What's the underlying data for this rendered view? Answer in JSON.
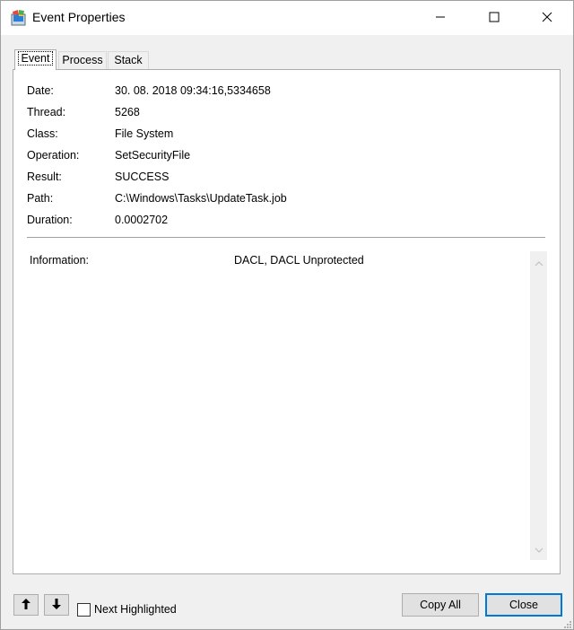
{
  "window": {
    "title": "Event Properties",
    "icon": "procmon-app-icon"
  },
  "titlebar_buttons": [
    "minimize-icon",
    "maximize-icon",
    "close-icon"
  ],
  "tabs": [
    {
      "label": "Event",
      "active": true
    },
    {
      "label": "Process",
      "active": false
    },
    {
      "label": "Stack",
      "active": false
    }
  ],
  "fields": [
    {
      "label": "Date:",
      "value": "30. 08. 2018 09:34:16,5334658"
    },
    {
      "label": "Thread:",
      "value": "5268"
    },
    {
      "label": "Class:",
      "value": "File System"
    },
    {
      "label": "Operation:",
      "value": "SetSecurityFile"
    },
    {
      "label": "Result:",
      "value": "SUCCESS"
    },
    {
      "label": "Path:",
      "value": "C:\\Windows\\Tasks\\UpdateTask.job"
    },
    {
      "label": "Duration:",
      "value": "0.0002702"
    }
  ],
  "info": {
    "label": "Information:",
    "value": "DACL, DACL Unprotected"
  },
  "footer": {
    "prev_icon": "arrow-up-icon",
    "next_icon": "arrow-down-icon",
    "next_highlighted_label": "Next Highlighted",
    "next_highlighted_checked": false,
    "copy_all_label": "Copy All",
    "close_label": "Close"
  },
  "colors": {
    "accent": "#0078d7",
    "button_bg": "#e1e1e1",
    "window_bg": "#f0f0f0"
  }
}
